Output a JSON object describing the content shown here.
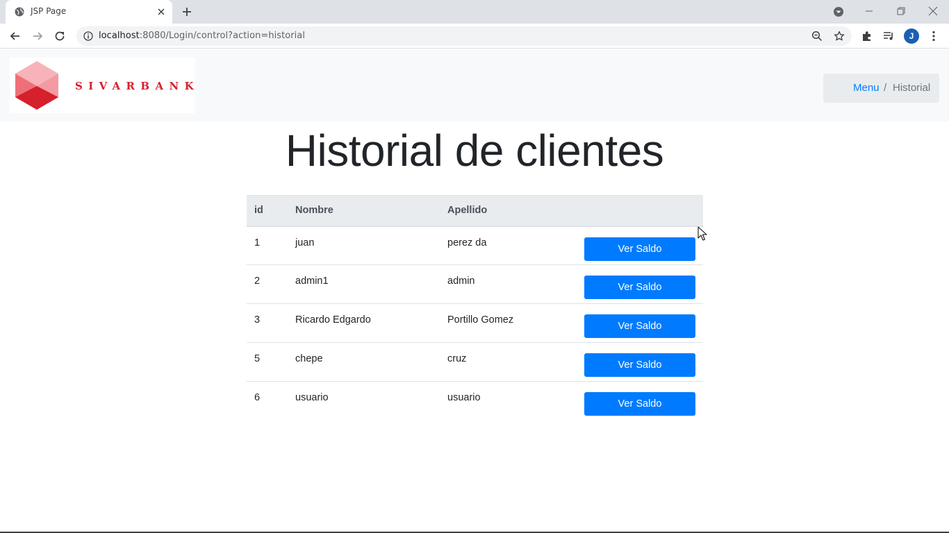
{
  "browser": {
    "tab_title": "JSP Page",
    "url_host": "localhost",
    "url_rest": ":8080/Login/control?action=historial",
    "profile_initial": "J",
    "icons": [
      "globe-icon",
      "close-icon",
      "plus-icon",
      "tab-search-icon",
      "minimize-icon",
      "restore-icon",
      "window-close-icon",
      "back-icon",
      "forward-icon",
      "reload-icon",
      "info-icon",
      "zoom-icon",
      "star-icon",
      "extensions-icon",
      "media-icon",
      "kebab-menu-icon"
    ]
  },
  "header": {
    "logo_text": "SIVARBANK",
    "breadcrumb": {
      "menu": "Menu",
      "separator": "/",
      "current": "Historial"
    }
  },
  "page": {
    "title": "Historial de clientes"
  },
  "table": {
    "columns": [
      "id",
      "Nombre",
      "Apellido",
      ""
    ],
    "rows": [
      {
        "id": "1",
        "nombre": "juan",
        "apellido": "perez da",
        "action": "Ver Saldo"
      },
      {
        "id": "2",
        "nombre": "admin1",
        "apellido": "admin",
        "action": "Ver Saldo"
      },
      {
        "id": "3",
        "nombre": "Ricardo Edgardo",
        "apellido": "Portillo Gomez",
        "action": "Ver Saldo"
      },
      {
        "id": "5",
        "nombre": "chepe",
        "apellido": "cruz",
        "action": "Ver Saldo"
      },
      {
        "id": "6",
        "nombre": "usuario",
        "apellido": "usuario",
        "action": "Ver Saldo"
      }
    ]
  },
  "colors": {
    "primary": "#007bff",
    "logo_red": "#d6202c",
    "header_bg": "#f8f9fa",
    "breadcrumb_bg": "#e9ecef"
  }
}
